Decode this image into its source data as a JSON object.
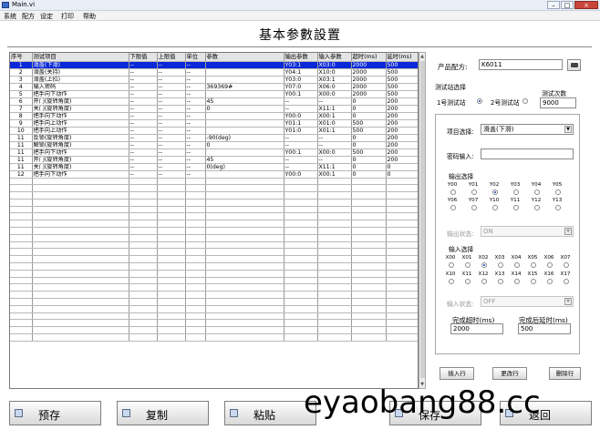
{
  "window": {
    "title": "Main.vi",
    "min": "–",
    "max": "□",
    "close": "×"
  },
  "menu": [
    "系统",
    "配方",
    "设定",
    "打印",
    "帮助"
  ],
  "page_title": "基本参數設置",
  "table": {
    "headers": [
      "序号",
      "测试项目",
      "下限值",
      "上限值",
      "单位",
      "参数",
      "输出参数",
      "输入参数",
      "超时(ms)",
      "延时(ms)"
    ],
    "rows": [
      [
        "1",
        "滑盖(下滑)",
        "--",
        "--",
        "--",
        "",
        "Y03:1",
        "X03:0",
        "2000",
        "500"
      ],
      [
        "2",
        "滑盖(关持)",
        "--",
        "--",
        "--",
        "",
        "Y04:1",
        "X10:0",
        "2000",
        "500"
      ],
      [
        "3",
        "滑盖(上拉)",
        "--",
        "--",
        "--",
        "",
        "Y03:0",
        "X03:1",
        "2000",
        "500"
      ],
      [
        "4",
        "输入密码",
        "--",
        "--",
        "--",
        "369369#",
        "Y07:0",
        "X06:0",
        "2000",
        "500"
      ],
      [
        "5",
        "把手向下动作",
        "--",
        "--",
        "--",
        "",
        "Y00:1",
        "X00:0",
        "2000",
        "500"
      ],
      [
        "6",
        "开门(旋转角度)",
        "--",
        "--",
        "--",
        "45",
        "--",
        "--",
        "0",
        "200"
      ],
      [
        "7",
        "关门(旋转角度)",
        "--",
        "--",
        "--",
        "0",
        "--",
        "X11:1",
        "0",
        "200"
      ],
      [
        "8",
        "把手向下动作",
        "--",
        "--",
        "--",
        "",
        "Y00:0",
        "X00:1",
        "0",
        "200"
      ],
      [
        "9",
        "把手向上动作",
        "--",
        "--",
        "--",
        "",
        "Y01:1",
        "X01:0",
        "500",
        "200"
      ],
      [
        "10",
        "把手向上动作",
        "--",
        "--",
        "--",
        "",
        "Y01:0",
        "X01:1",
        "500",
        "200"
      ],
      [
        "11",
        "反锁(旋转角度)",
        "--",
        "--",
        "--",
        "-90(deg)",
        "--",
        "--",
        "0",
        "200"
      ],
      [
        "11",
        "解锁(旋转角度)",
        "--",
        "--",
        "--",
        "0",
        "--",
        "--",
        "0",
        "200"
      ],
      [
        "11",
        "把手向下动作",
        "--",
        "--",
        "--",
        "",
        "Y00:1",
        "X00:0",
        "500",
        "200"
      ],
      [
        "11",
        "开门(旋转角度)",
        "--",
        "--",
        "--",
        "45",
        "--",
        "--",
        "0",
        "200"
      ],
      [
        "11",
        "关门(旋转角度)",
        "--",
        "--",
        "--",
        "0(deg)",
        "--",
        "X11:1",
        "0",
        "0"
      ],
      [
        "12",
        "把手向下动作",
        "--",
        "--",
        "--",
        "",
        "Y00:0",
        "X00:1",
        "0",
        "0"
      ]
    ],
    "selected_row": 0,
    "empty_rows": 23
  },
  "right": {
    "recipe_label": "产品配方:",
    "recipe_value": "K6011",
    "station_title": "测试站选择",
    "station1": "1号测试站",
    "station2": "2号测试站",
    "count_label": "测试次数",
    "count_value": "9000",
    "item_label": "项目选择:",
    "item_value": "滑盖(下滑)",
    "pwd_label": "密码输入:",
    "pwd_value": "",
    "out_title": "输出选择",
    "outputs": [
      "Y00",
      "Y01",
      "Y02",
      "Y03",
      "Y04",
      "Y05",
      "Y06",
      "Y07",
      "Y10",
      "Y11",
      "Y12",
      "Y13"
    ],
    "output_selected": "Y02",
    "out_state_label": "输出状态:",
    "out_state_value": "ON",
    "in_title": "输入选择",
    "inputs": [
      "X00",
      "X01",
      "X02",
      "X03",
      "X04",
      "X05",
      "X06",
      "X07",
      "X10",
      "X11",
      "X12",
      "X13",
      "X14",
      "X15",
      "X16",
      "X17"
    ],
    "input_selected": "X02",
    "in_state_label": "输入状态:",
    "in_state_value": "OFF",
    "timeout_label": "完成超时(ms)",
    "timeout_value": "2000",
    "delay_label": "完成后延时(ms)",
    "delay_value": "500",
    "btn_insert": "插入行",
    "btn_change": "更改行",
    "btn_delete": "删除行"
  },
  "bottom": {
    "prestore": "预存",
    "copy": "复制",
    "paste": "粘贴",
    "save": "保存",
    "back": "返回"
  },
  "watermark": "eyaobang88.cc"
}
